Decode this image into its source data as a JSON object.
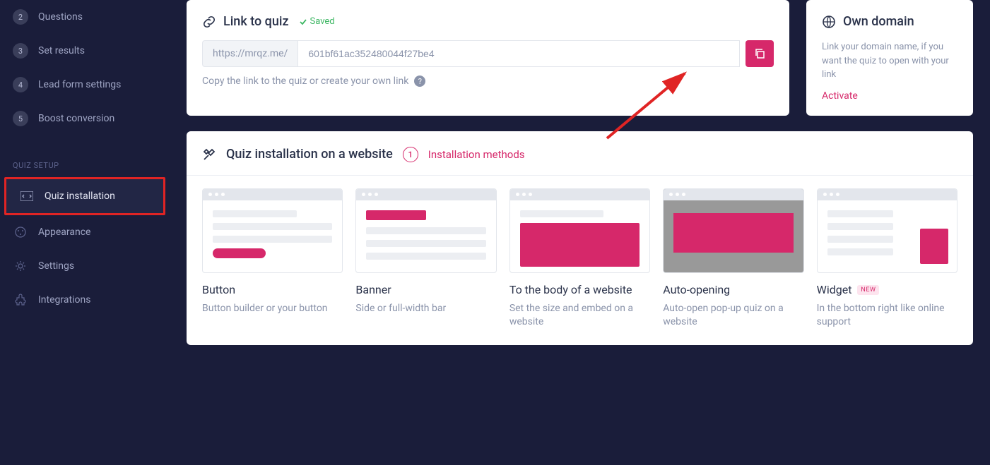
{
  "sidebar": {
    "steps": [
      {
        "num": "2",
        "label": "Questions"
      },
      {
        "num": "3",
        "label": "Set results"
      },
      {
        "num": "4",
        "label": "Lead form settings"
      },
      {
        "num": "5",
        "label": "Boost conversion"
      }
    ],
    "section": "QUIZ SETUP",
    "items": [
      {
        "label": "Quiz installation",
        "icon": "code-icon",
        "active": true
      },
      {
        "label": "Appearance",
        "icon": "palette-icon"
      },
      {
        "label": "Settings",
        "icon": "gear-icon"
      },
      {
        "label": "Integrations",
        "icon": "puzzle-icon"
      }
    ]
  },
  "link_card": {
    "title": "Link to quiz",
    "saved": "Saved",
    "prefix": "https://mrqz.me/",
    "value": "601bf61ac352480044f27be4",
    "hint": "Copy the link to the quiz or create your own link"
  },
  "domain_card": {
    "title": "Own domain",
    "desc": "Link your domain name, if you want the quiz to open with your link",
    "activate": "Activate"
  },
  "install_card": {
    "title": "Quiz installation on a website",
    "badge": "1",
    "methods": "Installation methods",
    "options": [
      {
        "title": "Button",
        "desc": "Button builder or your button",
        "type": "button"
      },
      {
        "title": "Banner",
        "desc": "Side or full-width bar",
        "type": "banner"
      },
      {
        "title": "To the body of a website",
        "desc": "Set the size and embed on a website",
        "type": "body"
      },
      {
        "title": "Auto-opening",
        "desc": "Auto-open pop-up quiz on a website",
        "type": "auto"
      },
      {
        "title": "Widget",
        "desc": "In the bottom right like online support",
        "type": "widget",
        "new": "NEW"
      }
    ]
  }
}
